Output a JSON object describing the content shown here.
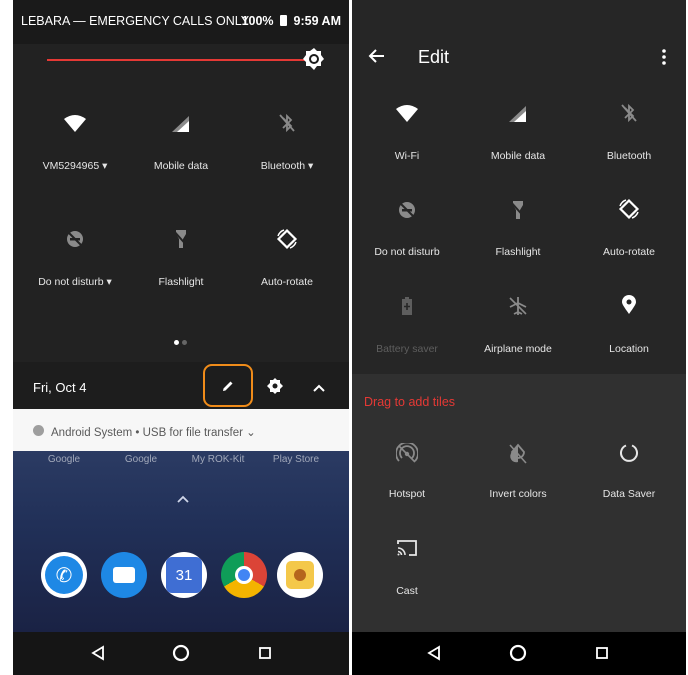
{
  "left": {
    "status": {
      "carrier": "LEBARA — EMERGENCY CALLS ONLY",
      "battery": "100%",
      "time": "9:59 AM"
    },
    "tiles": [
      {
        "label": "VM5294965",
        "icon": "wifi-icon",
        "dropdown": true
      },
      {
        "label": "Mobile data",
        "icon": "mobile-data-icon",
        "dropdown": false
      },
      {
        "label": "Bluetooth",
        "icon": "bluetooth-off-icon",
        "dropdown": true
      },
      {
        "label": "Do not disturb",
        "icon": "do-not-disturb-off-icon",
        "dropdown": true
      },
      {
        "label": "Flashlight",
        "icon": "flashlight-off-icon",
        "dropdown": false
      },
      {
        "label": "Auto-rotate",
        "icon": "auto-rotate-icon",
        "dropdown": false
      }
    ],
    "date": "Fri, Oct 4",
    "notification": "Android System • USB for file transfer",
    "home_apps": [
      "Google",
      "Google",
      "My ROK-Kit",
      "Play Store"
    ],
    "dock": [
      {
        "name": "phone-app-icon",
        "color": "#1e88e5"
      },
      {
        "name": "messages-app-icon",
        "color": "#1e88e5"
      },
      {
        "name": "calendar-app-icon",
        "color": "#3f6ed3",
        "text": "31"
      },
      {
        "name": "chrome-app-icon",
        "color": "#ffffff"
      },
      {
        "name": "camera-app-icon",
        "color": "#f4c84a"
      }
    ]
  },
  "right": {
    "title": "Edit",
    "active_tiles": [
      {
        "label": "Wi-Fi",
        "icon": "wifi-icon"
      },
      {
        "label": "Mobile data",
        "icon": "mobile-data-icon"
      },
      {
        "label": "Bluetooth",
        "icon": "bluetooth-off-icon"
      },
      {
        "label": "Do not disturb",
        "icon": "do-not-disturb-off-icon"
      },
      {
        "label": "Flashlight",
        "icon": "flashlight-off-icon"
      },
      {
        "label": "Auto-rotate",
        "icon": "auto-rotate-icon"
      },
      {
        "label": "Battery saver",
        "icon": "battery-saver-icon",
        "dimmed": true
      },
      {
        "label": "Airplane mode",
        "icon": "airplane-mode-off-icon"
      },
      {
        "label": "Location",
        "icon": "location-icon"
      }
    ],
    "drag_label": "Drag to add tiles",
    "extra_tiles": [
      {
        "label": "Hotspot",
        "icon": "hotspot-off-icon"
      },
      {
        "label": "Invert colors",
        "icon": "invert-colors-off-icon"
      },
      {
        "label": "Data Saver",
        "icon": "data-saver-icon"
      },
      {
        "label": "Cast",
        "icon": "cast-icon"
      }
    ]
  },
  "colors": {
    "accent_red": "#e53935",
    "highlight_orange": "#f08c1a"
  }
}
